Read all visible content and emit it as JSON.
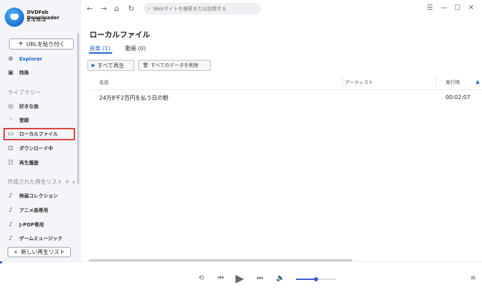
{
  "app": {
    "name": "DVDFab Downloader",
    "version": "2.1.0.2"
  },
  "sidebar": {
    "url_button": "URLを貼り付く",
    "items_top": [
      {
        "label": "Explorer",
        "icon": "globe-icon"
      },
      {
        "label": "特殊",
        "icon": "special-icon"
      }
    ],
    "library_heading": "ライブラリー",
    "library_items": [
      {
        "label": "好きな曲",
        "icon": "heart-music-icon"
      },
      {
        "label": "登録",
        "icon": "rss-icon"
      },
      {
        "label": "ローカルファイル",
        "icon": "folder-icon"
      },
      {
        "label": "ダウンロード中",
        "icon": "download-icon"
      },
      {
        "label": "再生履歴",
        "icon": "history-icon"
      }
    ],
    "playlists_heading": "作成された再生リスト",
    "playlists": [
      {
        "label": "映画コレクション"
      },
      {
        "label": "アニメ曲専用"
      },
      {
        "label": "J-POP専用"
      },
      {
        "label": "ゲームミュージック"
      }
    ],
    "new_playlist_button": "新しい再生リスト"
  },
  "topbar": {
    "search_placeholder": "Webサイトを検索または訪問する"
  },
  "main": {
    "title": "ローカルファイル",
    "tabs": [
      {
        "label": "音楽 (1)",
        "active": true
      },
      {
        "label": "動画 (0)",
        "active": false
      }
    ],
    "play_all_button": "すべて再生",
    "delete_all_button": "すべてのデータを削除",
    "table": {
      "headers": {
        "name": "名前",
        "artist": "アーティスト",
        "duration": "実行時"
      },
      "rows": [
        {
          "name": "24万8千2百円を払う日の朝",
          "artist": "",
          "duration": "00:02:07"
        }
      ]
    }
  },
  "player": {
    "volume_fraction": 0.5
  },
  "colors": {
    "accent": "#1a62c8",
    "highlight_border": "#d9413b"
  }
}
